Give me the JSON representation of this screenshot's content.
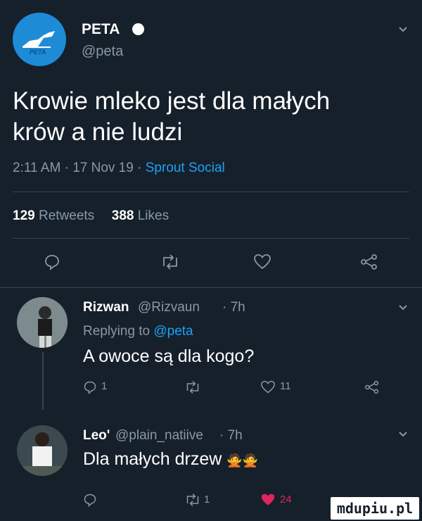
{
  "tweet": {
    "author_name": "PETA",
    "author_handle": "@peta",
    "avatar_text": "PETA",
    "text_line1": "Krowie mleko jest dla małych",
    "text_line2": "krów a nie ludzi",
    "time": "2:11 AM",
    "date": "17 Nov 19",
    "separator": "·",
    "source": "Sprout Social",
    "retweets_count": "129",
    "retweets_label": "Retweets",
    "likes_count": "388",
    "likes_label": "Likes"
  },
  "replies": [
    {
      "author_name": "Rizwan",
      "author_handle": "@Rizvaun",
      "time": "· 7h",
      "replying_to_label": "Replying to",
      "replying_to_handle": "@peta",
      "text": "A owoce są dla kogo?",
      "reply_count": "1",
      "retweet_count": "",
      "like_count": "11"
    },
    {
      "author_name": "Leo'",
      "author_handle": "@plain_natiive",
      "time": "· 7h",
      "text": "Dla małych drzew",
      "emoji": "🙅🙅",
      "reply_count": "",
      "retweet_count": "1",
      "like_count": "24"
    }
  ],
  "watermark": "mdupiu.pl",
  "colors": {
    "background": "#15202b",
    "accent": "#1da1f2",
    "muted": "#8899a6",
    "like_red": "#e0245e",
    "divider": "#38444d"
  }
}
